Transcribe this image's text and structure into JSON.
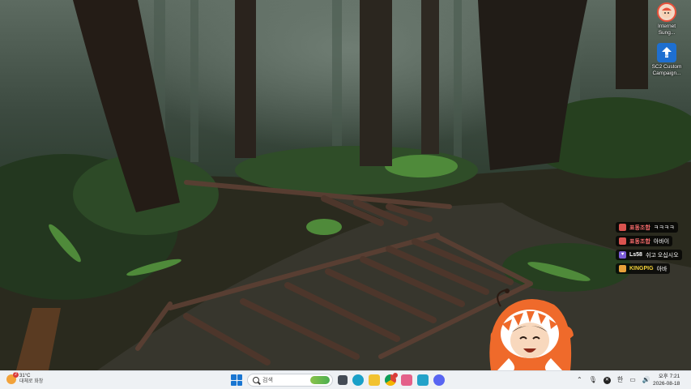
{
  "desktop_icons": [
    {
      "label": "Internet Sung...",
      "icon": "browser-avatar-icon",
      "color": "#e8503a"
    },
    {
      "label": "SC2 Custom Campaign...",
      "icon": "zip-archive-icon",
      "color": "#1e6fd0"
    }
  ],
  "chat": [
    {
      "badge_color": "#d9534f",
      "name": "표동조합",
      "name_color": "#ff6f6f",
      "message": "ㅋㅋㅋㅋ"
    },
    {
      "badge_color": "#d9534f",
      "name": "표동조합",
      "name_color": "#ff6f6f",
      "message": "아바이"
    },
    {
      "badge_color": "#7b5cd6",
      "name": "Ls58",
      "name_color": "#ffffff",
      "message": "쉬고 오십시오"
    },
    {
      "badge_color": "#e8a23a",
      "name": "KINGPIG",
      "name_color": "#f5d33a",
      "message": "아바"
    }
  ],
  "taskbar": {
    "weather": {
      "temp": "31°C",
      "desc": "대체로 화창",
      "badge": "2"
    },
    "search_placeholder": "검색",
    "apps": [
      {
        "icon": "task-view-icon",
        "color": "#444b55"
      },
      {
        "icon": "edge-browser-icon",
        "color": "#1aa0c8"
      },
      {
        "icon": "file-explorer-icon",
        "color": "#f2c230"
      },
      {
        "icon": "chrome-icon",
        "color": "#db4437",
        "notify": true
      },
      {
        "icon": "app-pink-icon",
        "color": "#e4608a"
      },
      {
        "icon": "app-doc-icon",
        "color": "#23a2c9"
      },
      {
        "icon": "discord-icon",
        "color": "#5865f2"
      }
    ],
    "tray": {
      "lang": "한",
      "clock_time": "오후 7:21",
      "clock_date": "2026-08-18"
    }
  }
}
